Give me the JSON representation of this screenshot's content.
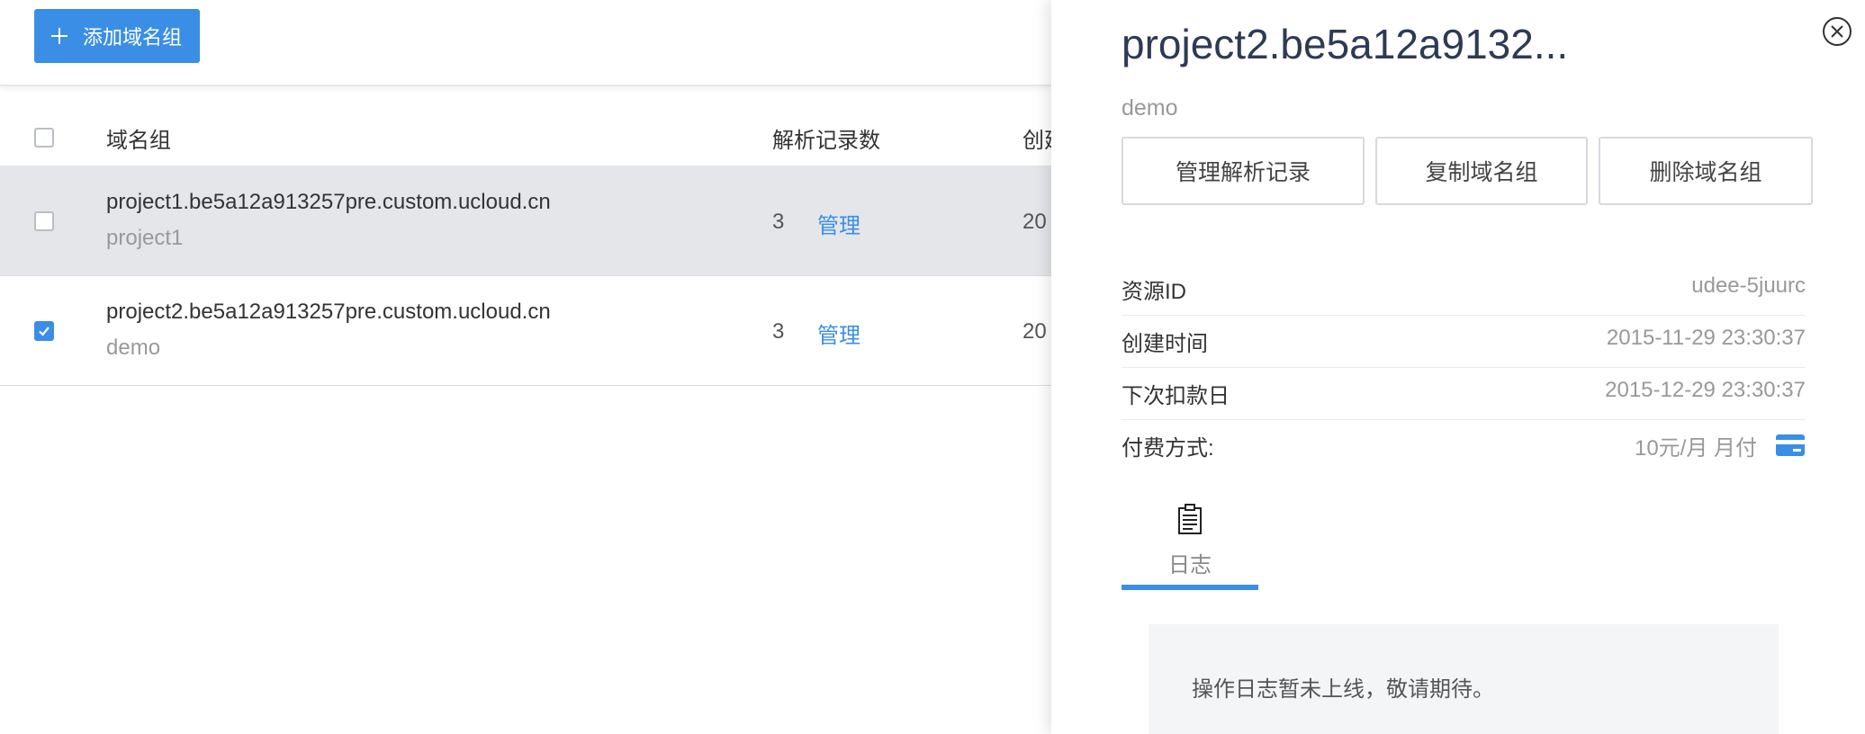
{
  "toolbar": {
    "add_label": "添加域名组"
  },
  "table": {
    "headers": {
      "domain_group": "域名组",
      "record_count": "解析记录数",
      "created": "创建"
    },
    "rows": [
      {
        "domain": "project1.be5a12a913257pre.custom.ucloud.cn",
        "remark": "project1",
        "count": "3",
        "manage": "管理",
        "created": "20",
        "checked": false
      },
      {
        "domain": "project2.be5a12a913257pre.custom.ucloud.cn",
        "remark": "demo",
        "count": "3",
        "manage": "管理",
        "created": "20",
        "checked": true
      }
    ]
  },
  "panel": {
    "title": "project2.be5a12a9132...",
    "subtitle": "demo",
    "buttons": {
      "manage_records": "管理解析记录",
      "copy_group": "复制域名组",
      "delete_group": "删除域名组"
    },
    "info": {
      "resource_id_label": "资源ID",
      "resource_id": "udee-5juurc",
      "created_label": "创建时间",
      "created": "2015-11-29 23:30:37",
      "next_charge_label": "下次扣款日",
      "next_charge": "2015-12-29 23:30:37",
      "payment_label": "付费方式:",
      "payment": "10元/月 月付"
    },
    "tab_log": "日志",
    "notice": "操作日志暂未上线，敬请期待。"
  },
  "colors": {
    "accent": "#3a8ee6",
    "title": "#2e3a55"
  },
  "icons": [
    "plus-icon",
    "checkbox-icon",
    "close-icon",
    "credit-card-icon",
    "clipboard-icon"
  ]
}
